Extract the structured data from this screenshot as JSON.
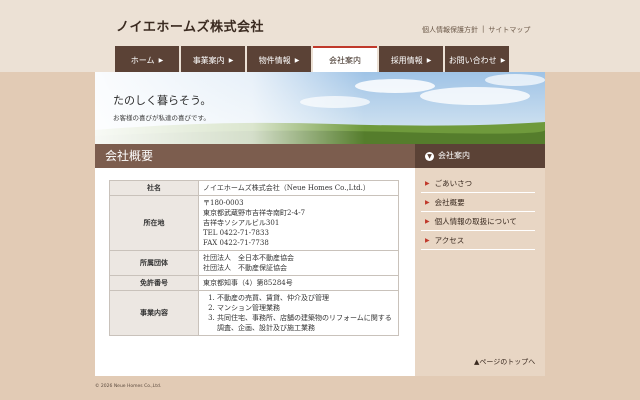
{
  "header": {
    "logo": "ノイエホームズ株式会社",
    "links": [
      "個人情報保護方針",
      "|",
      "サイトマップ"
    ]
  },
  "nav": [
    {
      "label": "ホーム",
      "arrow": "▶"
    },
    {
      "label": "事業案内",
      "arrow": "▶"
    },
    {
      "label": "物件情報",
      "arrow": "▶"
    },
    {
      "label": "会社案内",
      "arrow": ""
    },
    {
      "label": "採用情報",
      "arrow": "▶"
    },
    {
      "label": "お問い合わせ",
      "arrow": "▶"
    }
  ],
  "hero": {
    "title": "たのしく暮らそう。",
    "subtitle": "お客様の喜びが私達の喜びです。"
  },
  "main": {
    "heading": "会社概要",
    "rows": [
      {
        "label": "社名",
        "lines": [
          "ノイエホームズ株式会社（Neue Homes Co.,Ltd.）"
        ]
      },
      {
        "label": "所在地",
        "lines": [
          "〒180-0003",
          "東京都武蔵野市吉祥寺南町2-4-7",
          "吉祥寺ソシアルビル301",
          "TEL 0422-71-7833",
          "FAX 0422-71-7738"
        ]
      },
      {
        "label": "所属団体",
        "lines": [
          "社団法人　全日本不動産協会",
          "社団法人　不動産保証協会"
        ]
      },
      {
        "label": "免許番号",
        "lines": [
          "東京都知事（4）第85284号"
        ]
      },
      {
        "label": "事業内容",
        "items": [
          "不動産の売買、賃貸、仲介及び管理",
          "マンション管理業務",
          "共同住宅、事務所、店舗の建築物のリフォームに関する調査、企画、設計及び施工業務"
        ]
      }
    ]
  },
  "sidebar": {
    "heading": "会社案内",
    "icon": "▼",
    "items": [
      "ごあいさつ",
      "会社概要",
      "個人情報の取扱について",
      "アクセス"
    ]
  },
  "pagetop": "▲ページのトップへ",
  "copyright": "© 2026 Neue Homes Co.,Ltd."
}
